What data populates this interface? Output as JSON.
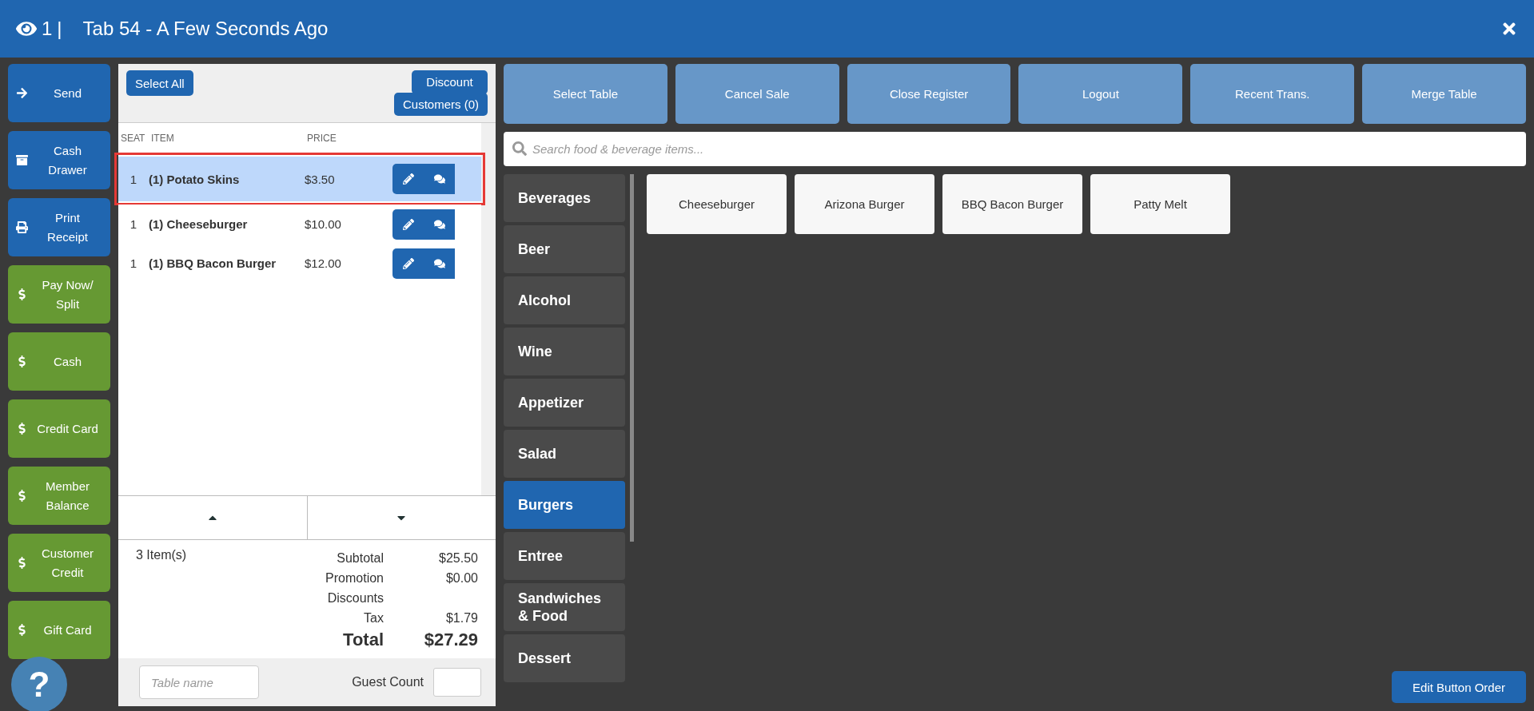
{
  "header": {
    "count": "1",
    "separator": "|",
    "title": "Tab 54 - A Few Seconds Ago"
  },
  "actions": [
    {
      "label": "Send",
      "kind": "send",
      "color": "#2066b0"
    },
    {
      "label": "Cash Drawer",
      "kind": "drawer",
      "color": "#2066b0"
    },
    {
      "label": "Print Receipt",
      "kind": "print",
      "color": "#2066b0"
    },
    {
      "label": "Pay Now/ Split",
      "kind": "dollar",
      "color": "#669933"
    },
    {
      "label": "Cash",
      "kind": "dollar",
      "color": "#669933"
    },
    {
      "label": "Credit Card",
      "kind": "dollar",
      "color": "#669933"
    },
    {
      "label": "Member Balance",
      "kind": "dollar",
      "color": "#669933"
    },
    {
      "label": "Customer Credit",
      "kind": "dollar",
      "color": "#669933"
    },
    {
      "label": "Gift Card",
      "kind": "dollar",
      "color": "#669933"
    }
  ],
  "order": {
    "select_all": "Select All",
    "discount": "Discount",
    "customers": "Customers (0)",
    "columns": [
      "SEAT",
      "ITEM",
      "PRICE"
    ],
    "rows": [
      {
        "seat": "1",
        "item": "(1) Potato Skins",
        "price": "$3.50",
        "selected": true
      },
      {
        "seat": "1",
        "item": "(1) Cheeseburger",
        "price": "$10.00",
        "selected": false
      },
      {
        "seat": "1",
        "item": "(1) BBQ Bacon Burger",
        "price": "$12.00",
        "selected": false
      }
    ],
    "item_count": "3 Item(s)",
    "totals": [
      {
        "label": "Subtotal",
        "value": "$25.50"
      },
      {
        "label": "Promotion",
        "value": "$0.00"
      },
      {
        "label": "Discounts"
      },
      {
        "label": "Tax",
        "value": "$1.79"
      },
      {
        "label": "Total",
        "value": "$27.29",
        "kind": "grand"
      }
    ],
    "table_name": {
      "placeholder": "Table name"
    },
    "guest_count": {
      "label": "Guest Count"
    }
  },
  "top_buttons": [
    "Select Table",
    "Cancel Sale",
    "Close Register",
    "Logout",
    "Recent Trans.",
    "Merge Table"
  ],
  "search": {
    "placeholder": "Search food & beverage items..."
  },
  "categories": [
    {
      "label": "Beverages",
      "selected": false
    },
    {
      "label": "Beer",
      "selected": false
    },
    {
      "label": "Alcohol",
      "selected": false
    },
    {
      "label": "Wine",
      "selected": false
    },
    {
      "label": "Appetizer",
      "selected": false
    },
    {
      "label": "Salad",
      "selected": false
    },
    {
      "label": "Burgers",
      "selected": true
    },
    {
      "label": "Entree",
      "selected": false
    },
    {
      "label": "Sandwiches & Food",
      "selected": false
    },
    {
      "label": "Dessert",
      "selected": false
    }
  ],
  "items": [
    "Cheeseburger",
    "Arizona Burger",
    "BBQ Bacon Burger",
    "Patty Melt"
  ],
  "edit_order": "Edit Button Order",
  "help": "?"
}
